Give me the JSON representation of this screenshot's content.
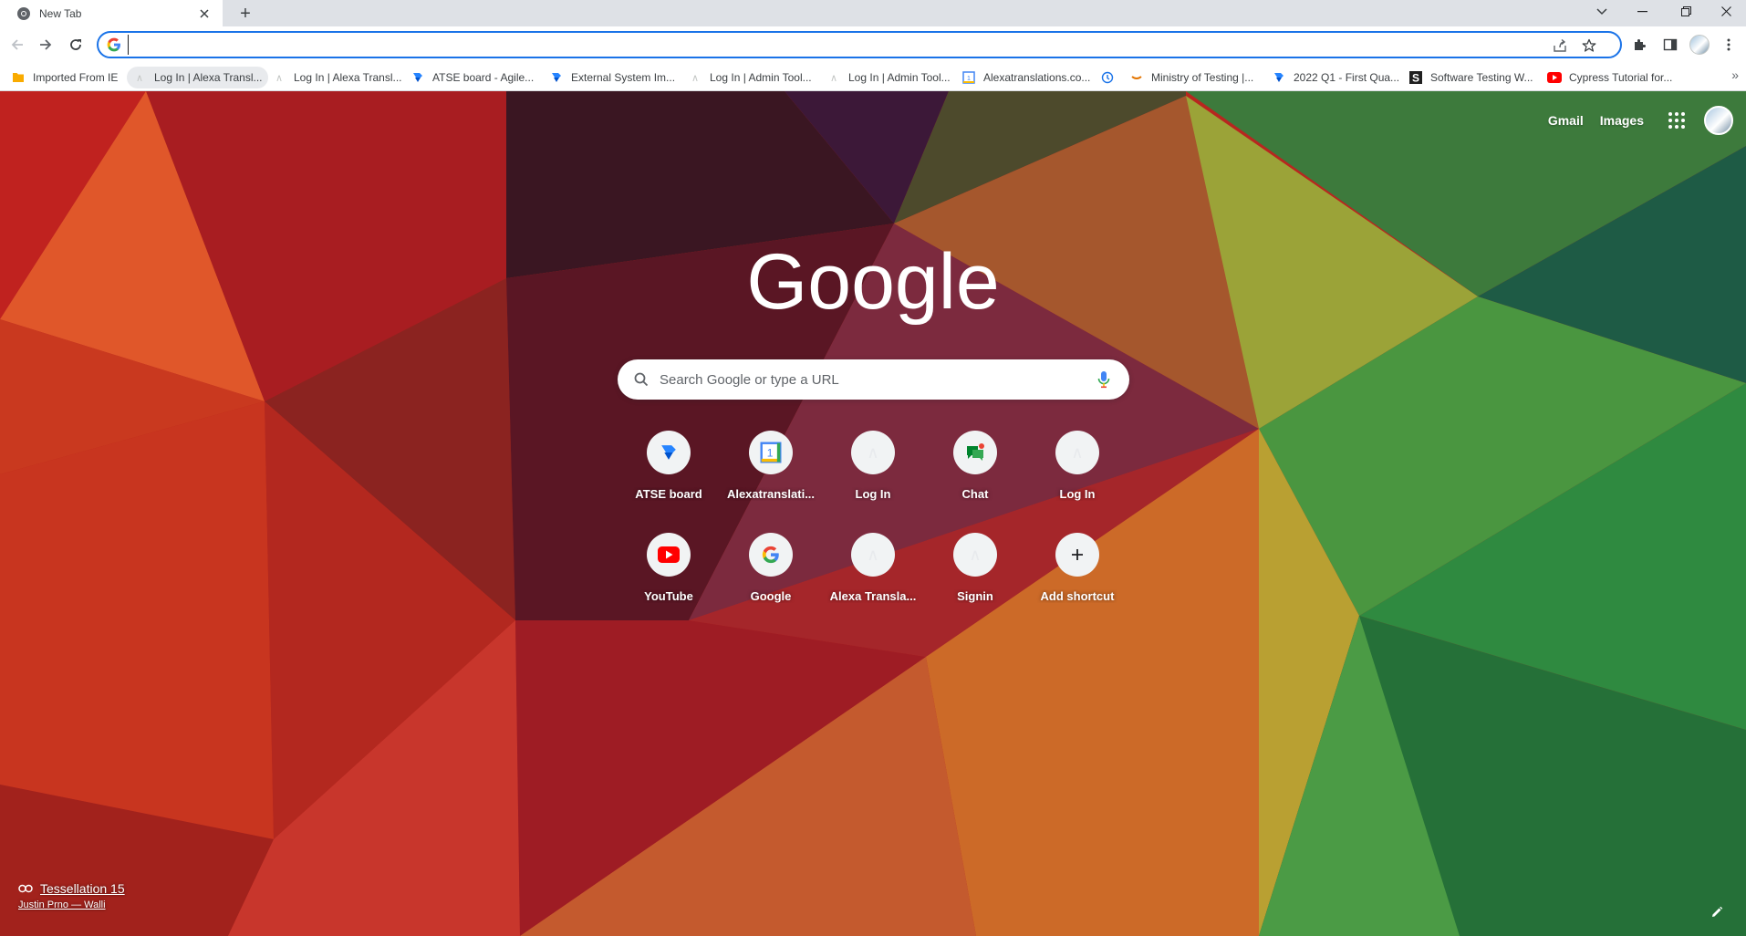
{
  "tab": {
    "title": "New Tab",
    "close_icon": "close-icon",
    "new_tab_symbol": "+"
  },
  "window_controls": {
    "tab_search": "⌄",
    "minimize": "–",
    "restore": "⧉",
    "close": "✕"
  },
  "omnibox": {
    "value": "",
    "placeholder": ""
  },
  "bookmarks": [
    {
      "label": "Imported From IE",
      "icon": "folder-icon"
    },
    {
      "label": "Log In | Alexa Transl...",
      "icon": "blank-page-icon",
      "active": true
    },
    {
      "label": "Log In | Alexa Transl...",
      "icon": "blank-page-icon"
    },
    {
      "label": "ATSE board - Agile...",
      "icon": "jira-icon"
    },
    {
      "label": "External System Im...",
      "icon": "jira-icon"
    },
    {
      "label": "Log In | Admin Tool...",
      "icon": "blank-page-icon"
    },
    {
      "label": "Log In | Admin Tool...",
      "icon": "blank-page-icon"
    },
    {
      "label": "Alexatranslations.co...",
      "icon": "calendar-icon"
    },
    {
      "label": "",
      "icon": "history-icon"
    },
    {
      "label": "Ministry of Testing |...",
      "icon": "mot-icon"
    },
    {
      "label": "2022 Q1 - First Qua...",
      "icon": "jira-icon"
    },
    {
      "label": "Software Testing W...",
      "icon": "s-icon"
    },
    {
      "label": "Cypress Tutorial for...",
      "icon": "youtube-icon"
    }
  ],
  "bookmarks_more": "»",
  "header_links": {
    "gmail": "Gmail",
    "images": "Images"
  },
  "logo_text": "Google",
  "search": {
    "placeholder": "Search Google or type a URL"
  },
  "shortcuts": [
    {
      "label": "ATSE board",
      "icon": "jira-icon"
    },
    {
      "label": "Alexatranslati...",
      "icon": "calendar-icon"
    },
    {
      "label": "Log In",
      "icon": "letter-a-icon"
    },
    {
      "label": "Chat",
      "icon": "chat-icon"
    },
    {
      "label": "Log In",
      "icon": "letter-a-icon"
    },
    {
      "label": "YouTube",
      "icon": "youtube-icon"
    },
    {
      "label": "Google",
      "icon": "google-g-icon"
    },
    {
      "label": "Alexa Transla...",
      "icon": "letter-a-icon"
    },
    {
      "label": "Signin",
      "icon": "letter-a-icon"
    },
    {
      "label": "Add shortcut",
      "icon": "plus-icon"
    }
  ],
  "attribution": {
    "title": "Tessellation 15",
    "author": "Justin Prno — Walli"
  },
  "colors": {
    "accent": "#1a73e8",
    "jira": "#2684ff",
    "youtube": "#ff0000"
  }
}
